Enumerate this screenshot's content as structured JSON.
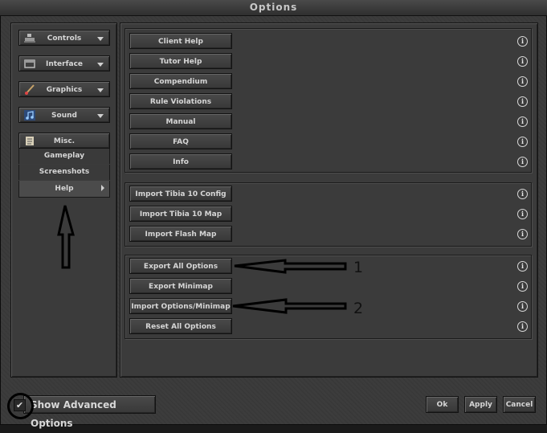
{
  "window": {
    "title": "Options"
  },
  "sidebar": {
    "menus": [
      {
        "label": "Controls",
        "icon": "controls-icon"
      },
      {
        "label": "Interface",
        "icon": "interface-icon"
      },
      {
        "label": "Graphics",
        "icon": "brush-icon"
      },
      {
        "label": "Sound",
        "icon": "music-note-icon"
      }
    ],
    "misc": {
      "label": "Misc.",
      "icon": "scroll-icon",
      "items": [
        "Gameplay",
        "Screenshots",
        "Help"
      ],
      "selected": "Help"
    }
  },
  "help_group": [
    "Client Help",
    "Tutor Help",
    "Compendium",
    "Rule Violations",
    "Manual",
    "FAQ",
    "Info"
  ],
  "import_group": [
    "Import Tibia 10 Config",
    "Import Tibia 10 Map",
    "Import Flash Map"
  ],
  "export_group": [
    "Export All Options",
    "Export Minimap",
    "Import Options/Minimap",
    "Reset All Options"
  ],
  "info_glyph": "i",
  "footer": {
    "show_advanced_label": "Show Advanced Options",
    "show_advanced_checked": true,
    "check_glyph": "✔",
    "ok_label": "Ok",
    "apply_label": "Apply",
    "cancel_label": "Cancel"
  },
  "annotations": {
    "first": "1",
    "second": "2"
  }
}
